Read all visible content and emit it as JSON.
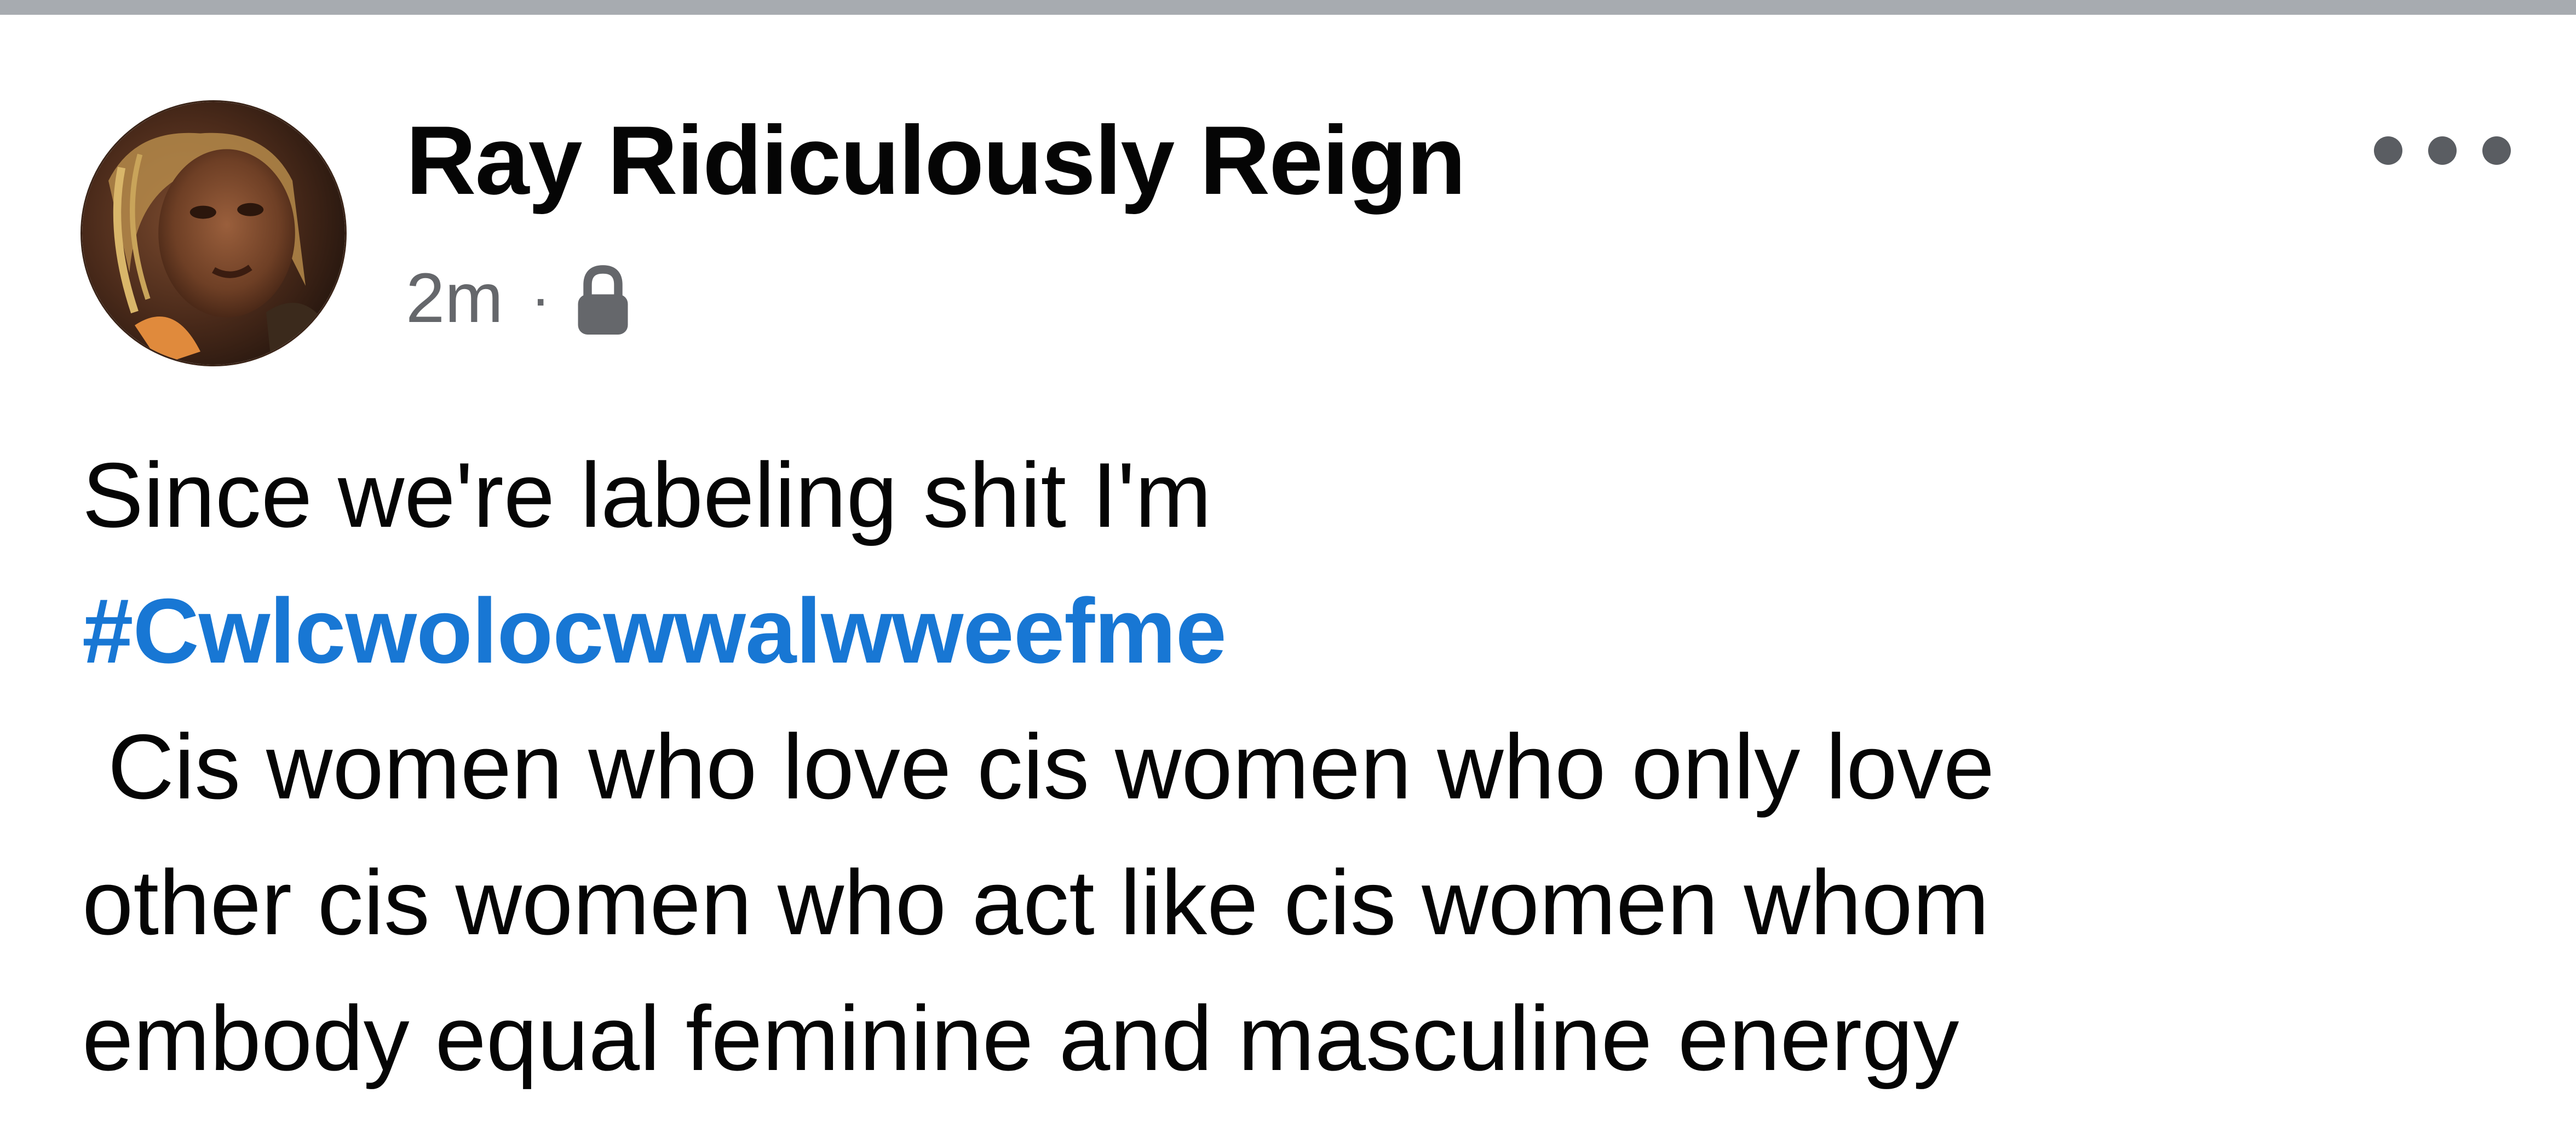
{
  "post": {
    "author": {
      "name": "Ray Ridiculously Reign",
      "avatar_icon": "profile-photo"
    },
    "timestamp": "2m",
    "separator": "·",
    "privacy_icon": "lock-icon",
    "more_icon": "more-options-icon",
    "body": {
      "line1": "Since we're labeling shit I'm",
      "hashtag": "#Cwlcwolocwwalwweefme",
      "line3": " Cis women who love cis women who only love",
      "line4": "other cis women who act like cis women whom",
      "line5": "embody equal feminine and masculine energy"
    }
  },
  "colors": {
    "name_text": "#050505",
    "meta_text": "#65676b",
    "hashtag": "#1877d4",
    "top_bar": "#a7abb0",
    "background": "#ffffff"
  }
}
